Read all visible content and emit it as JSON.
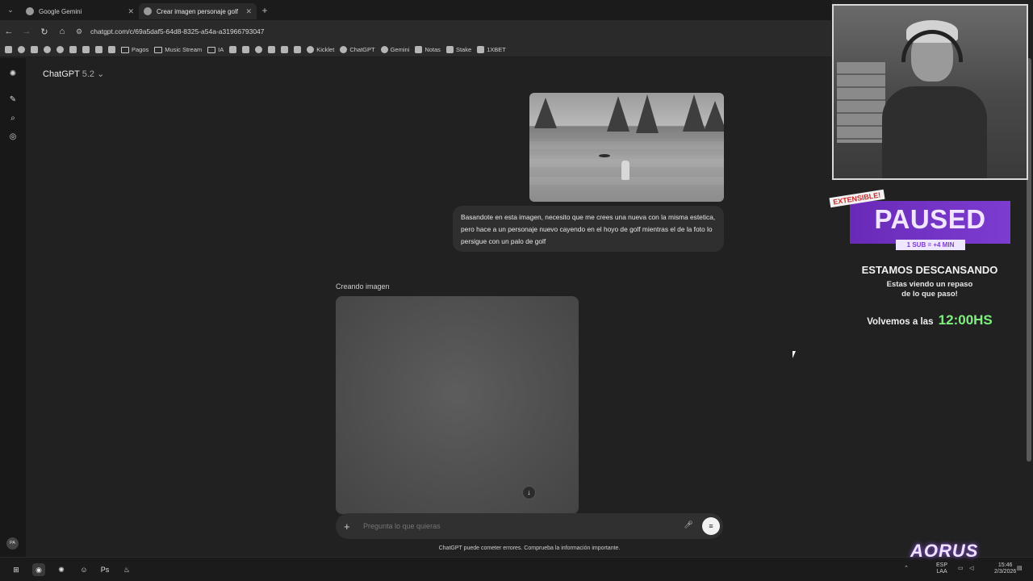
{
  "browser": {
    "tabs": [
      {
        "title": "Google Gemini",
        "active": false
      },
      {
        "title": "Crear imagen personaje golf",
        "active": true
      }
    ],
    "url": "chatgpt.com/c/69a5daf5-64d8-8325-a54a-a31966793047",
    "bookmarks": [
      "Pagos",
      "Music Stream",
      "IA",
      "Kicklet",
      "ChatGPT",
      "Gemini",
      "Notas",
      "Stake",
      "1XBET"
    ]
  },
  "app": {
    "model_name": "ChatGPT",
    "model_version": "5.2",
    "user_message": "Basandote en esta imagen, necesito que me crees una nueva con la misma estetica, pero hace a un personaje nuevo cayendo en el hoyo de golf mientras el de la foto lo persigue con un palo de golf",
    "status_label": "Creando imagen",
    "composer_placeholder": "Pregunta lo que quieras",
    "disclaimer": "ChatGPT puede cometer errores. Comprueba la información importante.",
    "avatar_initials": "PA"
  },
  "overlay": {
    "badge": "EXTENSIBLE!",
    "paused": "PAUSED",
    "paused_sub": "1 SUB = +4 MIN",
    "break_title": "ESTAMOS DESCANSANDO",
    "break_sub_line1": "Estas viendo un repaso",
    "break_sub_line2": "de lo que paso!",
    "return_prefix": "Volvemos a las",
    "return_time": "12:00HS",
    "brand": "AORUS",
    "colors": {
      "paused_bg": "#7c3cd0",
      "time": "#7ef07e"
    }
  },
  "taskbar": {
    "lang_line1": "ESP",
    "lang_line2": "LAA",
    "clock_time": "15:46",
    "clock_date": "2/3/2026"
  }
}
